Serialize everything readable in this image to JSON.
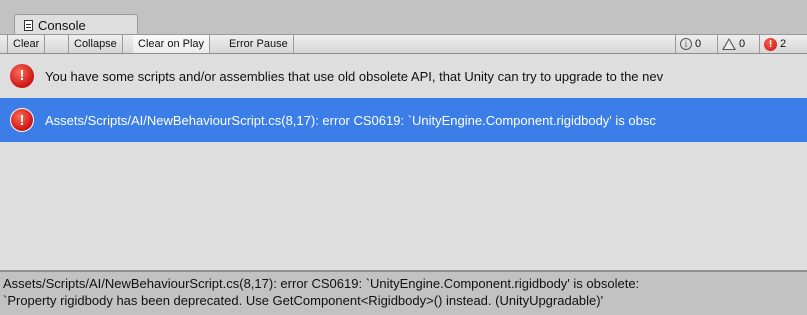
{
  "tab": {
    "title": "Console",
    "icon": "console-window-icon"
  },
  "toolbar": {
    "clear_label": "Clear",
    "collapse_label": "Collapse",
    "clear_on_play_label": "Clear on Play",
    "error_pause_label": "Error Pause",
    "info_count": "0",
    "warning_count": "0",
    "error_count": "2"
  },
  "log": {
    "entries": [
      {
        "type": "error",
        "icon": "error-icon",
        "message": "You have some scripts and/or assemblies that use old obsolete API, that Unity can try to upgrade to the nev",
        "selected": false
      },
      {
        "type": "error",
        "icon": "error-icon",
        "message": "Assets/Scripts/AI/NewBehaviourScript.cs(8,17): error CS0619: `UnityEngine.Component.rigidbody' is obsc",
        "selected": true
      }
    ]
  },
  "detail": {
    "line1": "Assets/Scripts/AI/NewBehaviourScript.cs(8,17): error CS0619: `UnityEngine.Component.rigidbody' is obsolete:",
    "line2": "`Property rigidbody has been deprecated. Use GetComponent<Rigidbody>() instead. (UnityUpgradable)'"
  },
  "colors": {
    "selection": "#3b7ee8",
    "list_background": "#dedede",
    "window_background": "#c2c2c2",
    "error_red": "#cc1410"
  }
}
